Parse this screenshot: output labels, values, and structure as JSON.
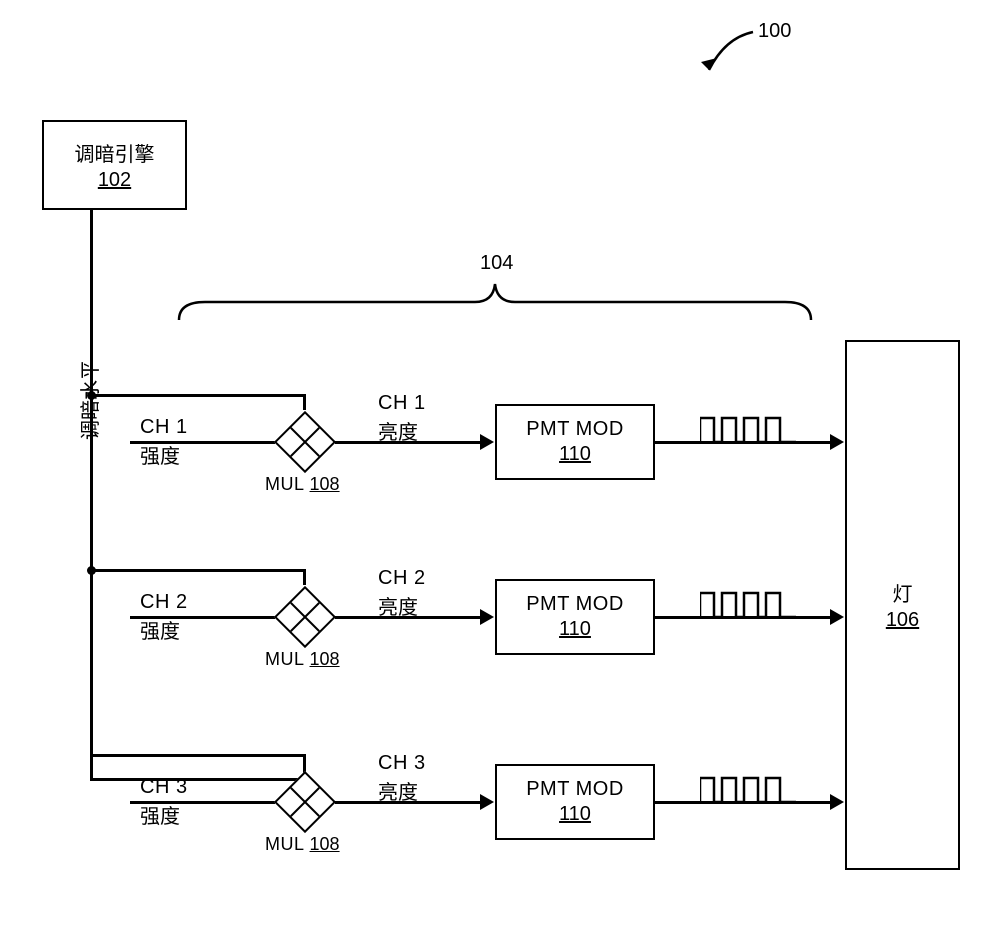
{
  "figure_ref": "100",
  "dimmer_engine": {
    "label": "调暗引擎",
    "ref": "102"
  },
  "dimming_level_label": "调暗水平",
  "channels_group_ref": "104",
  "lamp": {
    "label": "灯",
    "ref": "106"
  },
  "mul": {
    "label": "MUL",
    "ref": "108"
  },
  "pmt": {
    "label": "PMT MOD",
    "ref": "110"
  },
  "channels": [
    {
      "ch": "CH 1",
      "intensity_label": "强度",
      "brightness_label": "亮度"
    },
    {
      "ch": "CH 2",
      "intensity_label": "强度",
      "brightness_label": "亮度"
    },
    {
      "ch": "CH 3",
      "intensity_label": "强度",
      "brightness_label": "亮度"
    }
  ]
}
